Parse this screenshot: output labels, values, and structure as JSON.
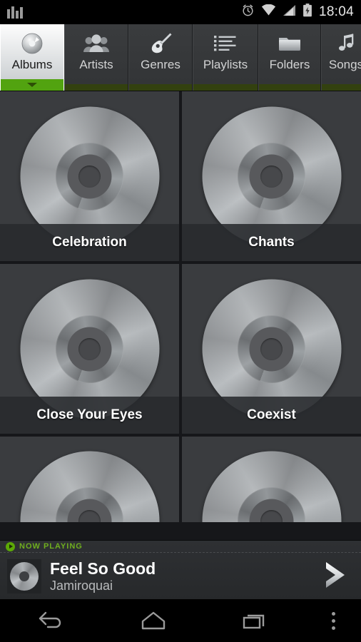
{
  "statusbar": {
    "notification_icon": "equalizer-icon",
    "alarm_icon": "alarm-clock-icon",
    "wifi_icon": "wifi-icon",
    "signal_icon": "cellular-signal-icon",
    "battery_icon": "battery-charging-icon",
    "time": "18:04"
  },
  "tabs": [
    {
      "label": "Albums",
      "icon": "cd-disc-icon",
      "active": true
    },
    {
      "label": "Artists",
      "icon": "people-icon",
      "active": false
    },
    {
      "label": "Genres",
      "icon": "guitar-icon",
      "active": false
    },
    {
      "label": "Playlists",
      "icon": "list-icon",
      "active": false
    },
    {
      "label": "Folders",
      "icon": "folder-icon",
      "active": false
    },
    {
      "label": "Songs",
      "icon": "music-note-icon",
      "active": false
    }
  ],
  "albums": [
    {
      "title": "Celebration"
    },
    {
      "title": "Chants"
    },
    {
      "title": "Close Your Eyes"
    },
    {
      "title": "Coexist"
    },
    {
      "title": ""
    },
    {
      "title": ""
    }
  ],
  "now_playing": {
    "header_label": "NOW PLAYING",
    "play_icon": "play-circle-icon",
    "title": "Feel So Good",
    "artist": "Jamiroquai",
    "next_icon": "chevron-right-icon",
    "thumb_icon": "album-art-disc-icon"
  },
  "navbar": {
    "back_label": "Back",
    "home_label": "Home",
    "recents_label": "Recent apps",
    "overflow_label": "More options"
  },
  "colors": {
    "accent_green": "#52a310",
    "accent_green_dim": "#33410f",
    "now_playing_green": "#6fae1e",
    "cell_background": "#3a3c3f",
    "grid_background": "#16171a",
    "tab_background": "#3a3c3e",
    "status_background": "#000000"
  }
}
